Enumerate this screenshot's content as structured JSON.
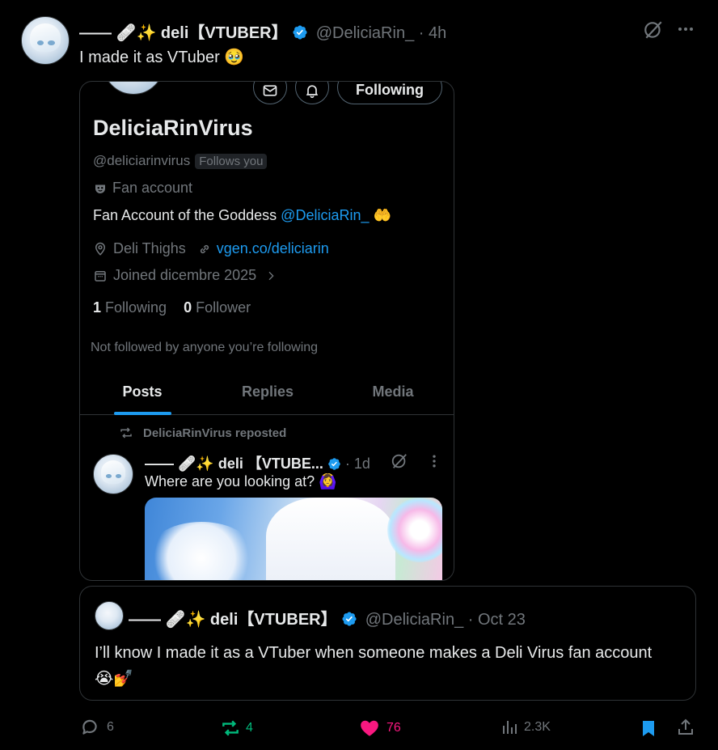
{
  "tweet": {
    "display_name": "—— 🩹✨ deli【VTUBER】",
    "handle": "@DeliciaRin_",
    "dot": "·",
    "time": "4h",
    "text": "I made it as VTuber 🥹"
  },
  "embed": {
    "buttons": {
      "follow_label": "Following"
    },
    "profile": {
      "name": "DeliciaRinVirus",
      "handle": "@deliciarinvirus",
      "follows_you": "Follows you",
      "category": "Fan account",
      "bio": "Fan Account of the Goddess",
      "bio_mention": "@DeliciaRin_",
      "bio_emoji": "🤲",
      "location": "Deli Thighs",
      "link": "vgen.co/deliciarin",
      "joined": "Joined dicembre 2025",
      "following_count": "1",
      "following_label": "Following",
      "follower_count": "0",
      "follower_label": "Follower",
      "not_followed": "Not followed by anyone you’re following"
    },
    "tabs": [
      {
        "label": "Posts",
        "active": true
      },
      {
        "label": "Replies",
        "active": false
      },
      {
        "label": "Media",
        "active": false
      }
    ],
    "repost": {
      "reposted_by": "DeliciaRinVirus reposted",
      "display_name": "—— 🩹✨ deli 【VTUBE...",
      "dot": "·",
      "time": "1d",
      "text": "Where are you looking at? 🙆‍♀️"
    }
  },
  "quote": {
    "display_name": "—— 🩹✨ deli【VTUBER】",
    "handle": "@DeliciaRin_",
    "dot": "·",
    "date": "Oct 23",
    "text": "I’ll know I made it as a VTuber when someone makes a Deli Virus fan account 😭💅"
  },
  "actions": {
    "replies": "6",
    "reposts": "4",
    "likes": "76",
    "views": "2.3K"
  },
  "colors": {
    "background": "#000000",
    "text": "#e7e9ea",
    "muted": "#71767b",
    "accent": "#1d9bf0",
    "repost": "#00ba7c",
    "like": "#f91880",
    "border": "#2f3336"
  },
  "icons": [
    "grok-icon",
    "more-icon",
    "mail-icon",
    "bell-icon",
    "mask-icon",
    "location-icon",
    "link-icon",
    "calendar-icon",
    "chevron-right-icon",
    "repost-icon",
    "verified-icon",
    "reply-icon",
    "like-icon",
    "views-icon",
    "bookmark-icon",
    "share-icon"
  ]
}
